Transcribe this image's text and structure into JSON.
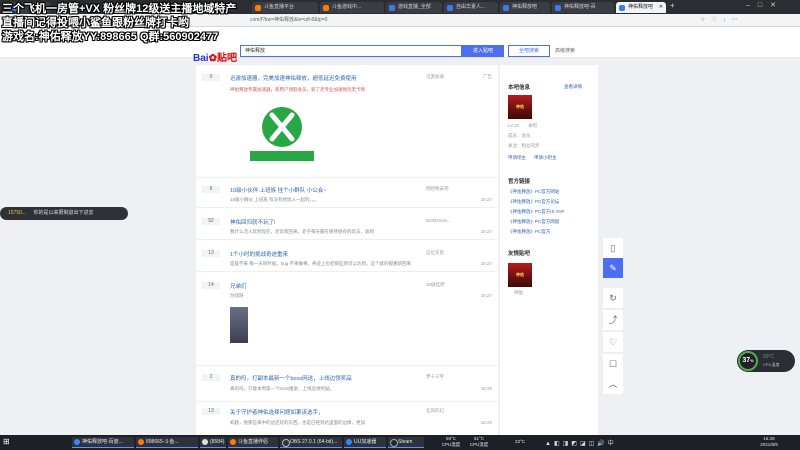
{
  "overlay": {
    "line1": "三个飞机一房管+VX 粉丝牌12级送主播地域特产",
    "line2": "直播间记得投喂小鲨鱼跟粉丝牌打卡哟",
    "line3": "游戏名:神佑释放YY:898665 Q群:560902477"
  },
  "browser": {
    "tabs": [
      "",
      "",
      "斗鱼直播平台",
      "斗鱼游戏中...",
      "游戏直播_全部",
      "自由华夏人...",
      "神佑释放吧",
      "神佑释放吧-百",
      "神佑释放吧"
    ],
    "url": "com/f?kw=神佑释放&ie=utf-8&tp=0"
  },
  "header": {
    "logo_left": "Bai",
    "logo_mid": "du",
    "logo_right": "贴吧",
    "search_value": "神佑释放",
    "enter_button": "进入贴吧",
    "global_button": "全吧搜索",
    "advanced_link": "高级搜索"
  },
  "posts": [
    {
      "replies": "0",
      "title": "迅游加速器，完美加速神佑释放，超低延迟免费使用",
      "excerpt": "神佑释放专属加速器，新用户领取会员，新了老专业加速畅玩无卡顿",
      "author": "迅游加速",
      "date": "广告"
    },
    {
      "replies": "6",
      "title": "10级小伙伴 上班族 挂个小群队 小公会~",
      "excerpt": "15级小群伙 上班族 有没有想加入一起的。。。",
      "author": "吧吧晚安吧",
      "date": "16:27"
    },
    {
      "replies": "92",
      "title": "神佑回归就不玩了!",
      "excerpt": "我什么活人玩到现在，老玩家回来，老子每天都在保持原有的玩法，收到",
      "author": "NOMOnen...",
      "date": "16:27"
    },
    {
      "replies": "13",
      "title": "1个小时的挑战奇迹重来",
      "excerpt": "是能不来 每一天的时候，bug 不来做事，奇迹上也老那些到可以达到，这个就的都重新回来",
      "author": "这位兄弟",
      "date": "16:27"
    },
    {
      "replies": "14",
      "title": "兄弟们",
      "excerpt": "为啥呀",
      "author": "10级挂吧",
      "date": "16:27"
    },
    {
      "replies": "2",
      "title": "真的吗，打副本最新一个boss网送，上线边领奖品",
      "excerpt": "真的吗，只能本周第一个boss推进，上线边领奖励。",
      "author": "梦十三宇",
      "date": "16:26"
    },
    {
      "replies": "13",
      "title": "关于守护者神佑选择问题如果该选手，",
      "excerpt": "如题，他那些来中的边还玩的东西，也是已经到达里面的边缘，更加",
      "author": "北风的幻",
      "date": "16:26"
    }
  ],
  "right": {
    "info_title": "本吧信息",
    "info_link": "查看详情",
    "lv_label": "LV.10",
    "lv_text": "本吧",
    "members": "成员：会员",
    "members_value": "会员",
    "focus": "关注：粉丝同步",
    "sign_link": "申请吧主",
    "sub_link": "申请小吧主",
    "official_title": "官方链接",
    "official_links": [
      "《神佑释放》PC官方网站",
      "《神佑释放》PC官方论坛",
      "《神佑释放》PC官方IS.YAP",
      "《神佑释放》PC官方网盘",
      "《神佑释放》PC官方"
    ],
    "friends_title": "友情贴吧",
    "friend_name": "神佑"
  },
  "toast": {
    "user": "15750...",
    "text": "你的是以来限制退出下进去"
  },
  "cpu": {
    "percent": "37",
    "unit": "%",
    "temp": "59°C",
    "label": "CPU温度"
  },
  "taskbar": {
    "items": [
      "神佑释放吧-百度...",
      "",
      "898665-斗鱼...",
      "(8584)",
      "斗鱼直播伴侣",
      "OBS 27.0.1 (64-bit)...",
      "UU加速器",
      "Steam"
    ],
    "cpu_temp1": "59°C",
    "cpu_temp1_label": "CPU温度",
    "cpu_temp2": "51°C",
    "cpu_temp2_label": "CPU温度",
    "weather": "23°C",
    "time": "16:28",
    "date": "2021/8/9"
  }
}
